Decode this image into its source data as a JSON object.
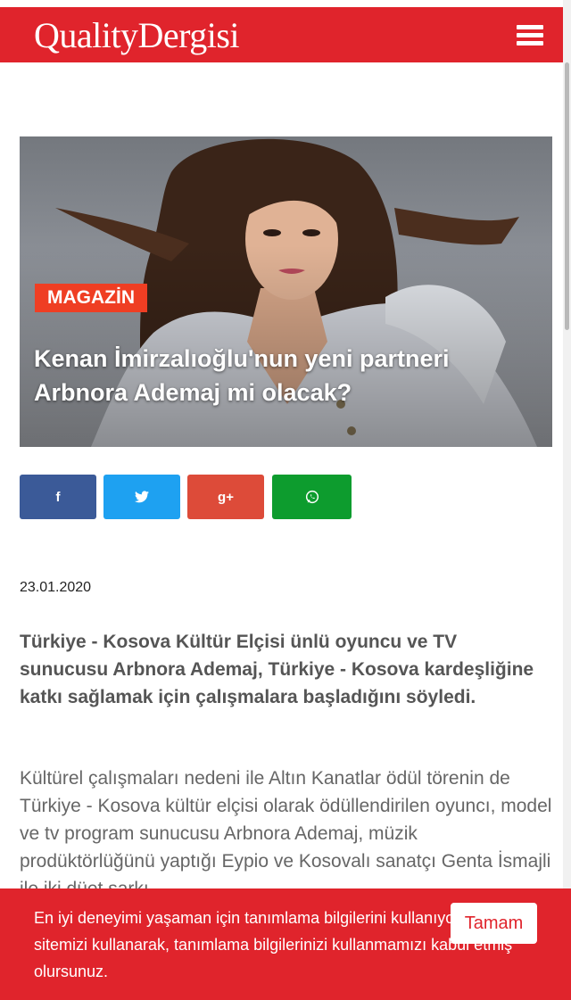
{
  "header": {
    "logo_text": "QualityDergisi",
    "brand_color": "#e0242c"
  },
  "hero": {
    "category": "MAGAZİN",
    "title": "Kenan İmirzalıoğlu'nun yeni partneri Arbnora Ademaj mi olacak?"
  },
  "share": {
    "facebook_label": "f",
    "twitter_label": "🐦",
    "googleplus_label": "g+",
    "whatsapp_label": "✆",
    "colors": {
      "facebook": "#3b5a98",
      "twitter": "#1ea1f1",
      "googleplus": "#dd4b39",
      "whatsapp": "#0d9c2e"
    }
  },
  "article": {
    "date": "23.01.2020",
    "lead": "Türkiye - Kosova Kültür Elçisi ünlü oyuncu ve TV sunucusu Arbnora Ademaj, Türkiye - Kosova kardeşliğine katkı sağlamak için çalışmalara başladığını söyledi.",
    "body": "Kültürel çalışmaları nedeni ile Altın Kanatlar ödül törenin de Türkiye - Kosova kültür elçisi olarak ödüllendirilen oyuncı, model ve tv program sunucusu Arbnora Ademaj, müzik prodüktörlüğünü yaptığı Eypio ve Kosovalı sanatçı Genta İsmajli ile iki düet şarkı"
  },
  "cookie": {
    "message": "En iyi deneyimi yaşaman için tanımlama bilgilerini kullanıyoruz. Web sitemizi kullanarak, tanımlama bilgilerinizi kullanmamızı kabul etmiş olursunuz.",
    "accept_label": "Tamam"
  }
}
